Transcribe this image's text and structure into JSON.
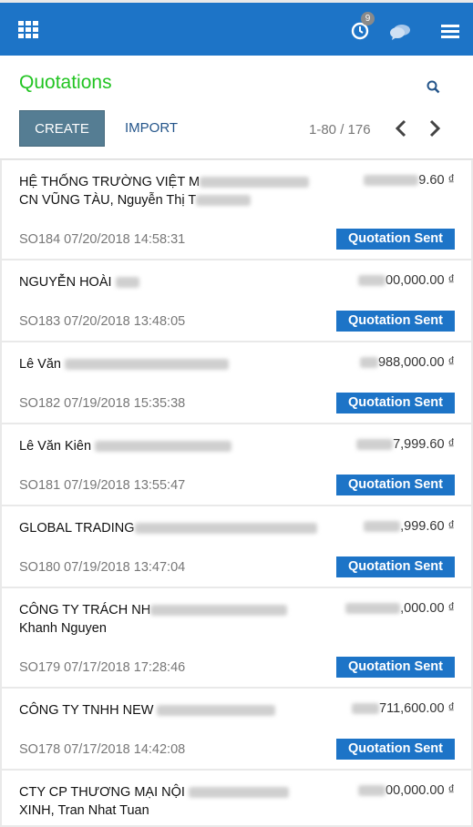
{
  "topbar": {
    "apps_icon": "apps-grid-icon",
    "activity_icon": "clock-icon",
    "activity_count": "9",
    "chat_icon": "chat-icon",
    "menu_icon": "hamburger-menu-icon",
    "color": "#1d74c7"
  },
  "page": {
    "title": "Quotations",
    "title_color": "#22c422",
    "search_icon": "search-icon"
  },
  "controls": {
    "create_label": "CREATE",
    "import_label": "IMPORT",
    "pager": "1-80 / 176"
  },
  "rows": [
    {
      "name_line1": "HỆ THỐNG TRƯỜNG VIỆT M",
      "name_line2": "CN VŨNG TÀU, Nguyễn Thị T",
      "amount": "9.60 ₫",
      "ref": "SO184 07/20/2018 14:58:31",
      "status": "Quotation Sent"
    },
    {
      "name_line1": "NGUYỄN HOÀI",
      "name_line2": "",
      "amount": "00,000.00 ₫",
      "ref": "SO183 07/20/2018 13:48:05",
      "status": "Quotation Sent"
    },
    {
      "name_line1": "Lê Văn",
      "name_line2": "",
      "amount": "988,000.00 ₫",
      "ref": "SO182 07/19/2018 15:35:38",
      "status": "Quotation Sent"
    },
    {
      "name_line1": "Lê Văn Kiên",
      "name_line2": "",
      "amount": "7,999.60 ₫",
      "ref": "SO181 07/19/2018 13:55:47",
      "status": "Quotation Sent"
    },
    {
      "name_line1": "GLOBAL TRADING",
      "name_line2": "",
      "amount": ",999.60 ₫",
      "ref": "SO180 07/19/2018 13:47:04",
      "status": "Quotation Sent"
    },
    {
      "name_line1": "CÔNG TY TRÁCH NH",
      "name_line2": "Khanh Nguyen",
      "amount": ",000.00 ₫",
      "ref": "SO179 07/17/2018 17:28:46",
      "status": "Quotation Sent"
    },
    {
      "name_line1": "CÔNG TY TNHH NEW",
      "name_line2": "",
      "amount": "711,600.00 ₫",
      "ref": "SO178 07/17/2018 14:42:08",
      "status": "Quotation Sent"
    },
    {
      "name_line1": "CTY CP THƯƠNG MẠI NỘI",
      "name_line2": "XINH, Tran Nhat Tuan",
      "amount": "00,000.00 ₫",
      "ref": "",
      "status": ""
    }
  ]
}
